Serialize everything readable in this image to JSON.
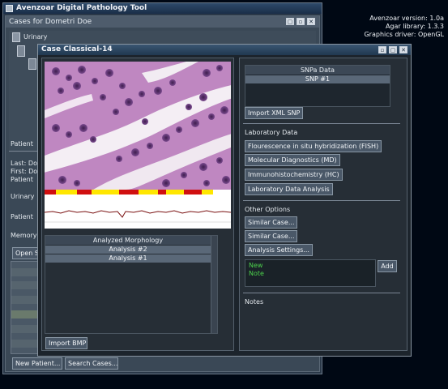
{
  "desktop": {
    "info_lines": [
      "Avenzoar version: 1.0a",
      "Agar library: 1.3.3",
      "Graphics driver: OpenGL"
    ]
  },
  "app": {
    "title": "Avenzoar Digital Pathology Tool",
    "cases_title": "Cases for Dometri Doe",
    "tree_item": "Urinary",
    "left_labels": [
      "Patient",
      "Last: Do",
      "First: Do",
      "Patient",
      "Urinary",
      "Patient",
      "Memory"
    ],
    "open_button": "Open S",
    "new_patient_button": "New Patient...",
    "search_cases_button": "Search Cases..."
  },
  "case_window": {
    "title": "Case Classical-14",
    "morphology_header": "Analyzed Morphology",
    "analyses": [
      "Analysis #2",
      "Analysis #1"
    ],
    "import_bmp": "Import BMP",
    "snp_header": "SNPa Data",
    "snp_items": [
      "SNP #1"
    ],
    "import_xml_snp": "Import XML SNP",
    "lab_header": "Laboratory Data",
    "lab_buttons": [
      "Flourescence in situ hybridization (FISH)",
      "Molecular Diagnostics (MD)",
      "Immunohistochemistry (HC)",
      "Laboratory Data Analysis"
    ],
    "other_header": "Other Options",
    "other_buttons": [
      "Similar Case...",
      "Similar Case...",
      "Analysis Settings..."
    ],
    "note_text": "New Note",
    "add_button": "Add",
    "notes_header": "Notes"
  },
  "colors": {
    "note_text": "#4cd24c",
    "tissue_pink": "#c890c8",
    "tissue_purple": "#6a3c78",
    "signal_red": "#d01010",
    "signal_yellow": "#ffe600"
  }
}
